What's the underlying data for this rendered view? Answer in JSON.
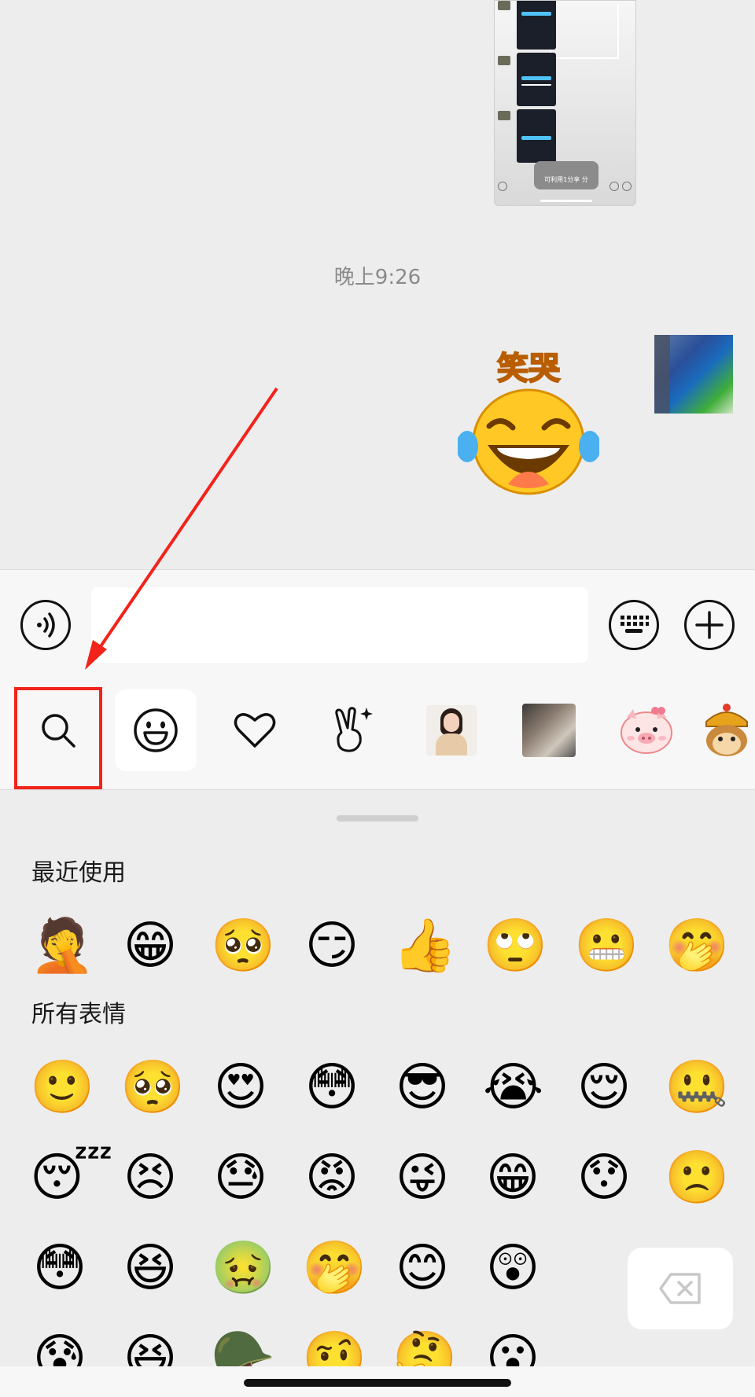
{
  "chat": {
    "screenshot_message": {
      "pill_text": "可利用1分享 分"
    },
    "timestamp": "晚上9:26",
    "sticker": {
      "caption": "笑哭",
      "glyph": "😂"
    }
  },
  "input_bar": {
    "voice_icon": "voice-icon",
    "input_placeholder": "",
    "keyboard_icon": "keyboard-icon",
    "plus_icon": "plus-icon"
  },
  "emoji_tabs": [
    {
      "name": "search",
      "icon": "search-icon"
    },
    {
      "name": "emoji",
      "icon": "smiley-icon",
      "active": true
    },
    {
      "name": "favorites",
      "icon": "heart-icon"
    },
    {
      "name": "stickers",
      "icon": "victory-hand-icon"
    },
    {
      "name": "pack-1",
      "glyph": "👩"
    },
    {
      "name": "pack-2",
      "glyph": "🐈"
    },
    {
      "name": "pack-3",
      "glyph": "🐷"
    },
    {
      "name": "pack-4",
      "glyph": "🐒"
    }
  ],
  "panel": {
    "recent_title": "最近使用",
    "recent": [
      "🤦",
      "😁",
      "🥺",
      "😏",
      "👍",
      "🙄",
      "😬",
      "🤭"
    ],
    "all_title": "所有表情",
    "all": [
      [
        "🙂",
        "🥺",
        "😍",
        "😳",
        "😎",
        "😭",
        "😌",
        "🤐"
      ],
      [
        "😴",
        "😣",
        "😓",
        "😡",
        "😜",
        "😁",
        "😯",
        "🙁"
      ],
      [
        "😳",
        "😆",
        "🤢",
        "🤭",
        "😊",
        "😲"
      ],
      [
        "😰",
        "😆",
        "🪖",
        "🤨",
        "🤔",
        "😮"
      ]
    ],
    "delete_icon": "backspace-icon"
  },
  "colors": {
    "highlight": "#f2231b",
    "background": "#ededed",
    "accent": "#f7941d"
  }
}
